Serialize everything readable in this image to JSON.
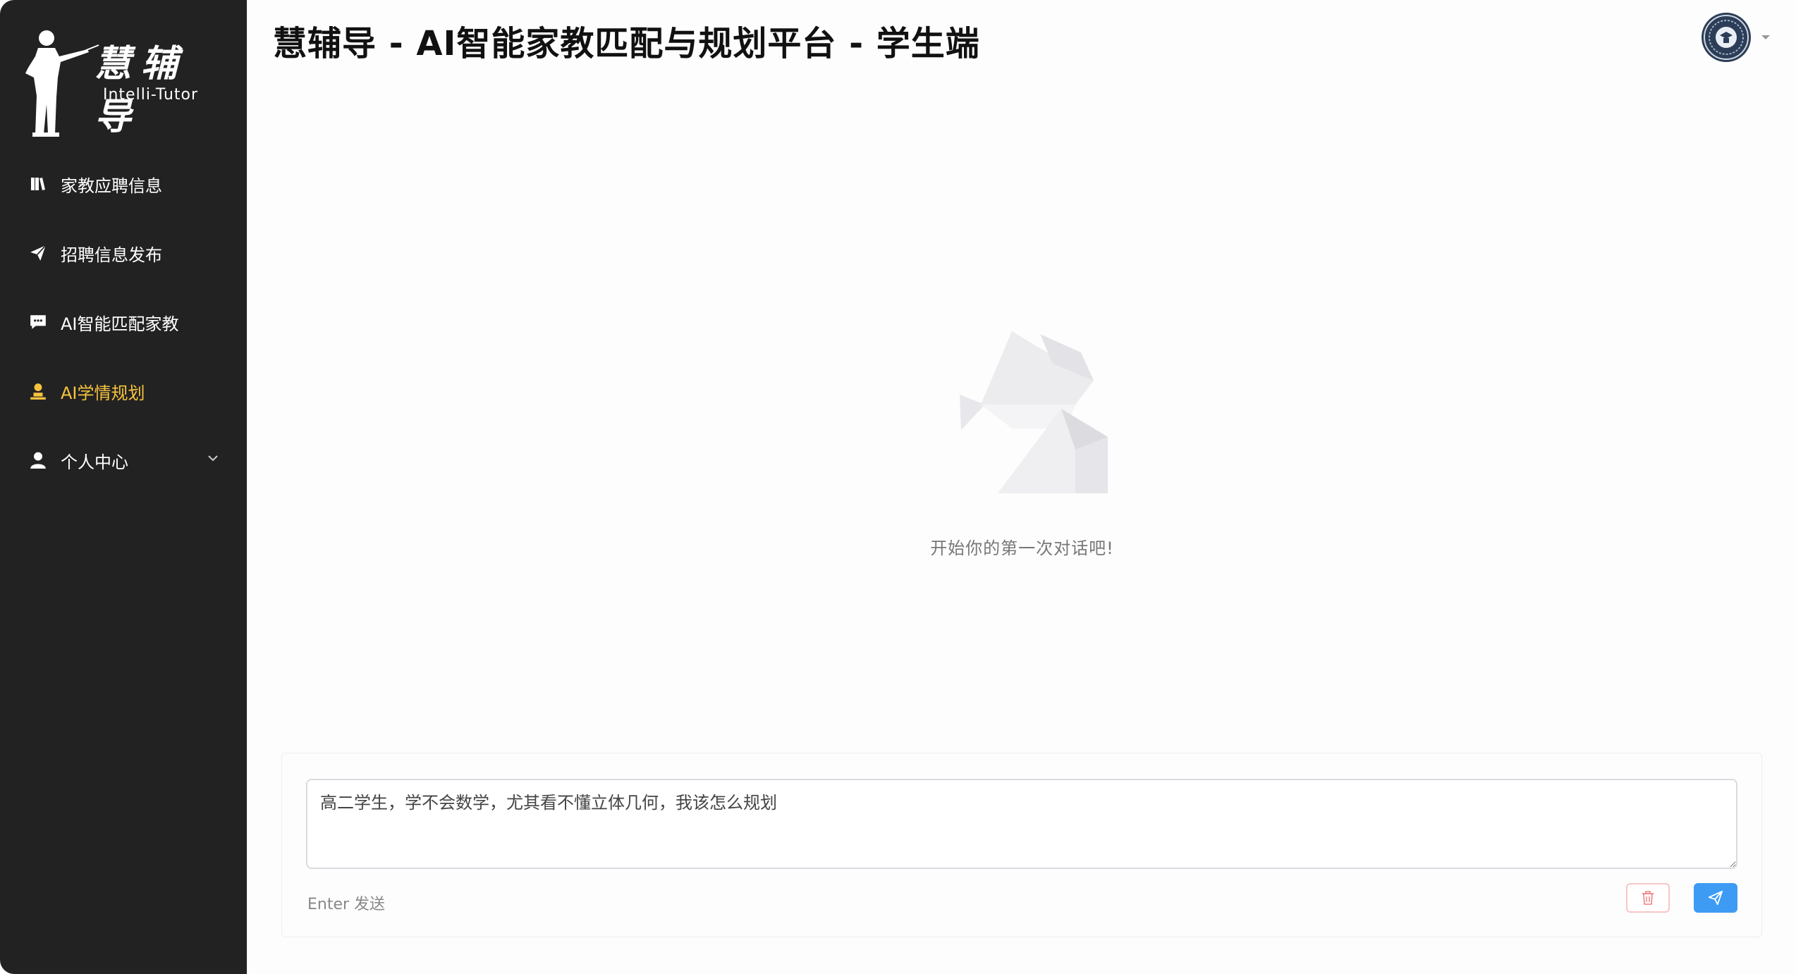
{
  "sidebar": {
    "brand_cn": "慧辅导",
    "brand_en": "Intelli-Tutor",
    "items": [
      {
        "label": "家教应聘信息",
        "icon": "book-icon"
      },
      {
        "label": "招聘信息发布",
        "icon": "send-icon"
      },
      {
        "label": "AI智能匹配家教",
        "icon": "chat-icon"
      },
      {
        "label": "AI学情规划",
        "icon": "user-stamp-icon",
        "active": true
      },
      {
        "label": "个人中心",
        "icon": "person-icon",
        "expandable": true
      }
    ],
    "active_color": "#f7c33f",
    "background": "#222222"
  },
  "header": {
    "title": "慧辅导 - AI智能家教匹配与规划平台 - 学生端"
  },
  "empty_state": {
    "text": "开始你的第一次对话吧!"
  },
  "composer": {
    "input_value": "高二学生，学不会数学，尤其看不懂立体几何，我该怎么规划",
    "hint": "Enter 发送",
    "send_color": "#3e9bf4"
  }
}
